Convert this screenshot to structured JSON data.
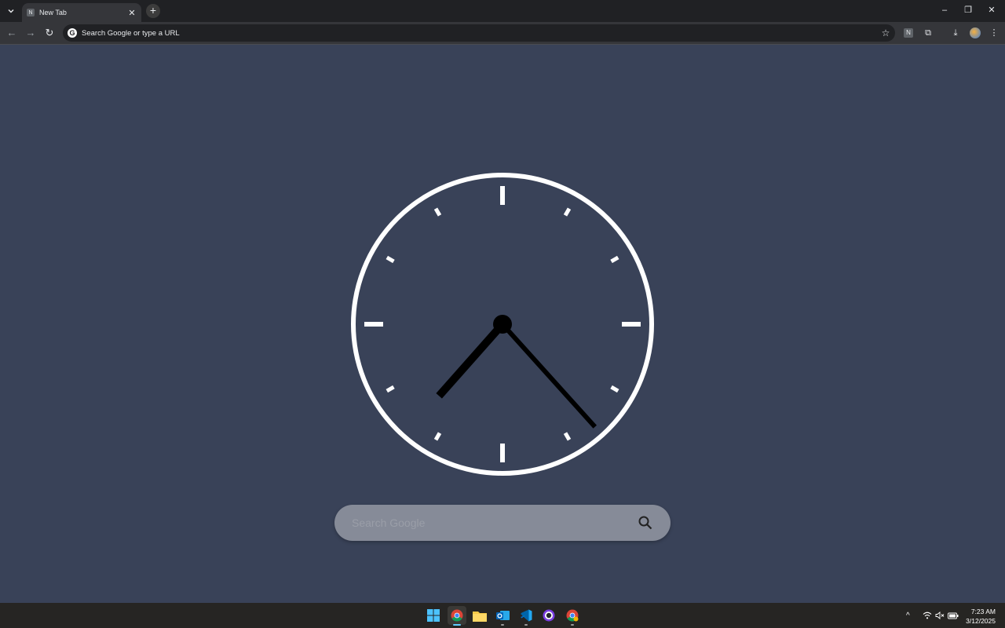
{
  "browser": {
    "tab": {
      "favicon": "N",
      "title": "New Tab",
      "close": "✕"
    },
    "new_tab": "+",
    "tab_search_icon": "chevron-down-icon",
    "window_controls": {
      "minimize": "–",
      "restore": "❐",
      "close": "✕"
    },
    "nav": {
      "back": "←",
      "forward": "→",
      "reload": "↻"
    },
    "omnibox": {
      "logo": "G",
      "placeholder": "Search Google or type a URL"
    },
    "bookmark_icon": "☆",
    "extensions": {
      "n_ext": "N",
      "puzzle": "⧉",
      "download": "⤓",
      "menu": "⋮"
    }
  },
  "page": {
    "clock": {
      "hour": 7,
      "minute": 23,
      "face_color": "#ffffff",
      "hand_color": "#000000"
    },
    "search": {
      "placeholder": "Search Google"
    }
  },
  "taskbar": {
    "apps": [
      "windows-start",
      "chrome",
      "file-explorer",
      "outlook",
      "vscode",
      "github-desktop",
      "chrome-profile-2"
    ],
    "tray": {
      "chevron": "^",
      "time": "7:23 AM",
      "date": "3/12/2025"
    }
  },
  "colors": {
    "background": "#394258",
    "search_bg": "#868b98",
    "accent": "#60cdff"
  }
}
